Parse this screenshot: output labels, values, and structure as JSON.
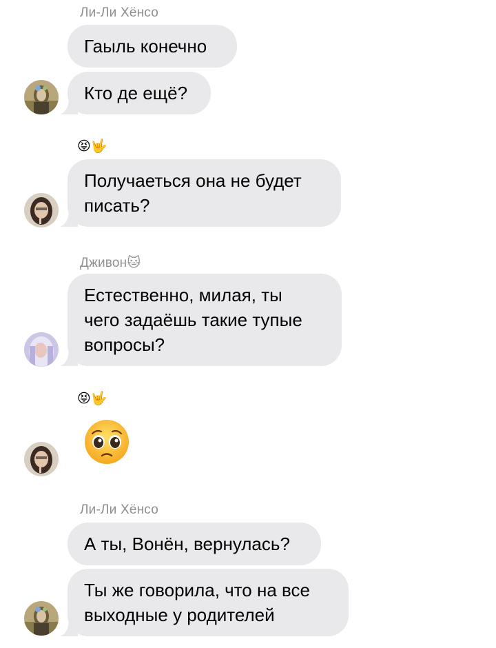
{
  "chat": {
    "sender_1": "Ли-Ли Хёнсо",
    "msg_1": "Гаыль конечно",
    "msg_2": "Кто де ещё?",
    "reaction_1": "😝🤟",
    "msg_3_line1": "Получаеться она не будет",
    "msg_3_line2": "писать?",
    "sender_2": "Дживон🐱",
    "msg_4_line1": "Естественно, милая, ты",
    "msg_4_line2": "чего задаёшь такие тупые",
    "msg_4_line3": "вопросы?",
    "reaction_2": "😝🤟",
    "sticker_emoji": "pleading-face",
    "sender_3": "Ли-Ли Хёнсо",
    "msg_5": "А ты, Вонён, вернулась?",
    "msg_6_line1": "Ты же говорила, что на все",
    "msg_6_line2": "выходные у родителей"
  },
  "colors": {
    "bubble_bg": "#e9e9eb",
    "sender_name": "#8e8e93",
    "text": "#000000",
    "background": "#ffffff"
  }
}
